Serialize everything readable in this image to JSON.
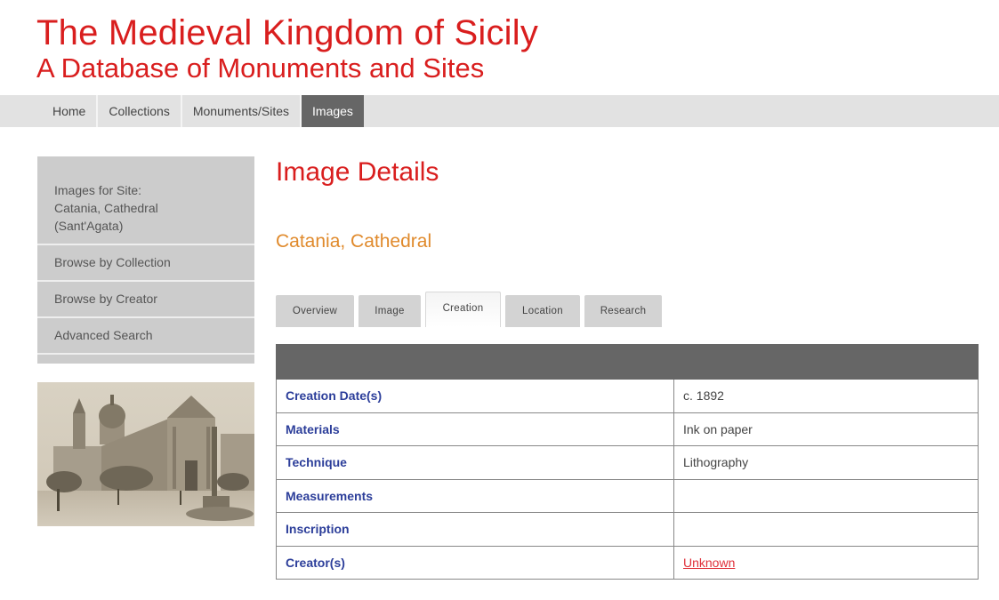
{
  "header": {
    "title": "The Medieval Kingdom of Sicily",
    "subtitle": "A Database of Monuments and Sites"
  },
  "nav": {
    "items": [
      {
        "label": "Home",
        "active": false
      },
      {
        "label": "Collections",
        "active": false
      },
      {
        "label": "Monuments/Sites",
        "active": false
      },
      {
        "label": "Images",
        "active": true
      }
    ]
  },
  "sidebar": {
    "heading_lines": [
      "Images for Site:",
      "Catania, Cathedral",
      "(Sant'Agata)"
    ],
    "items": [
      {
        "label": "Browse by Collection"
      },
      {
        "label": "Browse by Creator"
      },
      {
        "label": "Advanced Search"
      }
    ],
    "thumbnail_alt": "Lithograph of Catania Cathedral with fountain in the piazza"
  },
  "main": {
    "page_title": "Image Details",
    "record_title": "Catania, Cathedral",
    "tabs": [
      {
        "label": "Overview",
        "active": false
      },
      {
        "label": "Image",
        "active": false
      },
      {
        "label": "Creation",
        "active": true
      },
      {
        "label": "Location",
        "active": false
      },
      {
        "label": "Research",
        "active": false
      }
    ],
    "table": {
      "rows": [
        {
          "label": "Creation Date(s)",
          "value": "c. 1892",
          "link": false
        },
        {
          "label": "Materials",
          "value": "Ink on paper",
          "link": false
        },
        {
          "label": "Technique",
          "value": "Lithography",
          "link": false
        },
        {
          "label": "Measurements",
          "value": "",
          "link": false
        },
        {
          "label": "Inscription",
          "value": "",
          "link": false
        },
        {
          "label": "Creator(s)",
          "value": "Unknown",
          "link": true
        }
      ]
    }
  },
  "colors": {
    "brand_red": "#d91e1e",
    "subtitle_orange": "#e08a2c",
    "label_blue": "#2c3e9a",
    "link_red": "#e0303a",
    "nav_active": "#666666"
  }
}
